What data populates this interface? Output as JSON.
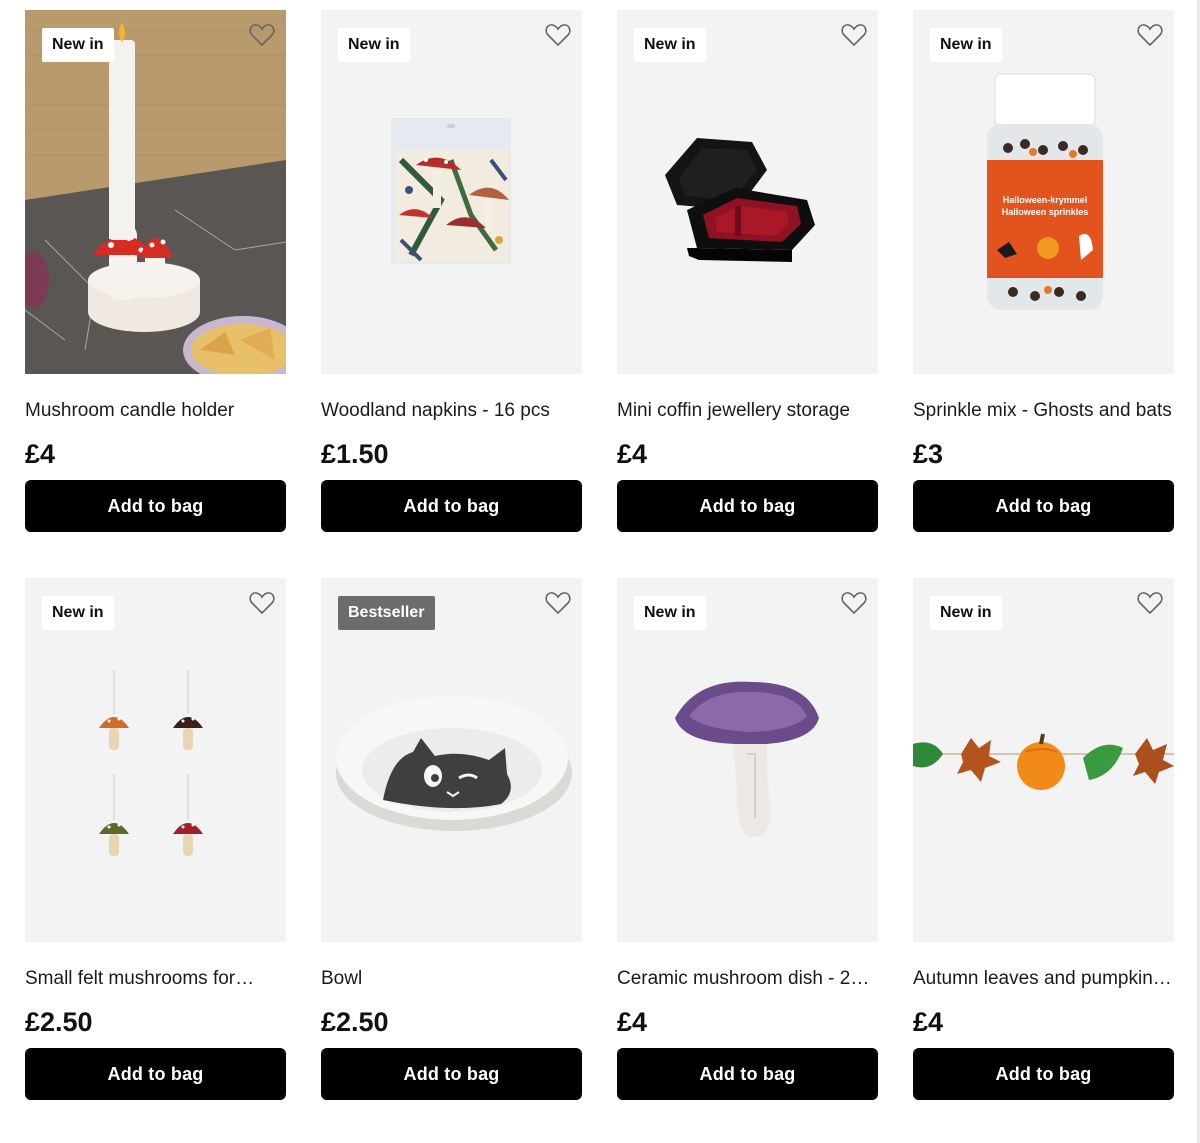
{
  "products": [
    {
      "badge": "New in",
      "badge_style": "light",
      "title": "Mushroom candle holder",
      "price": "£4",
      "button": "Add to bag"
    },
    {
      "badge": "New in",
      "badge_style": "light",
      "title": "Woodland napkins - 16 pcs",
      "price": "£1.50",
      "button": "Add to bag"
    },
    {
      "badge": "New in",
      "badge_style": "light",
      "title": "Mini coffin jewellery storage",
      "price": "£4",
      "button": "Add to bag"
    },
    {
      "badge": "New in",
      "badge_style": "light",
      "title": "Sprinkle mix - Ghosts and bats",
      "price": "£3",
      "button": "Add to bag",
      "label_line_1": "Halloween-krymmel",
      "label_line_2": "Halloween sprinkles"
    },
    {
      "badge": "New in",
      "badge_style": "light",
      "title": "Small felt mushrooms for…",
      "price": "£2.50",
      "button": "Add to bag"
    },
    {
      "badge": "Bestseller",
      "badge_style": "dark",
      "title": "Bowl",
      "price": "£2.50",
      "button": "Add to bag"
    },
    {
      "badge": "New in",
      "badge_style": "light",
      "title": "Ceramic mushroom dish - 20…",
      "price": "£4",
      "button": "Add to bag"
    },
    {
      "badge": "New in",
      "badge_style": "light",
      "title": "Autumn leaves and pumpkins…",
      "price": "£4",
      "button": "Add to bag"
    }
  ],
  "icons": {
    "wishlist": "heart-outline-icon"
  },
  "colors": {
    "button_bg": "#000000",
    "badge_dark": "#6c6c6c",
    "tile_bg": "#f3f3f3"
  }
}
